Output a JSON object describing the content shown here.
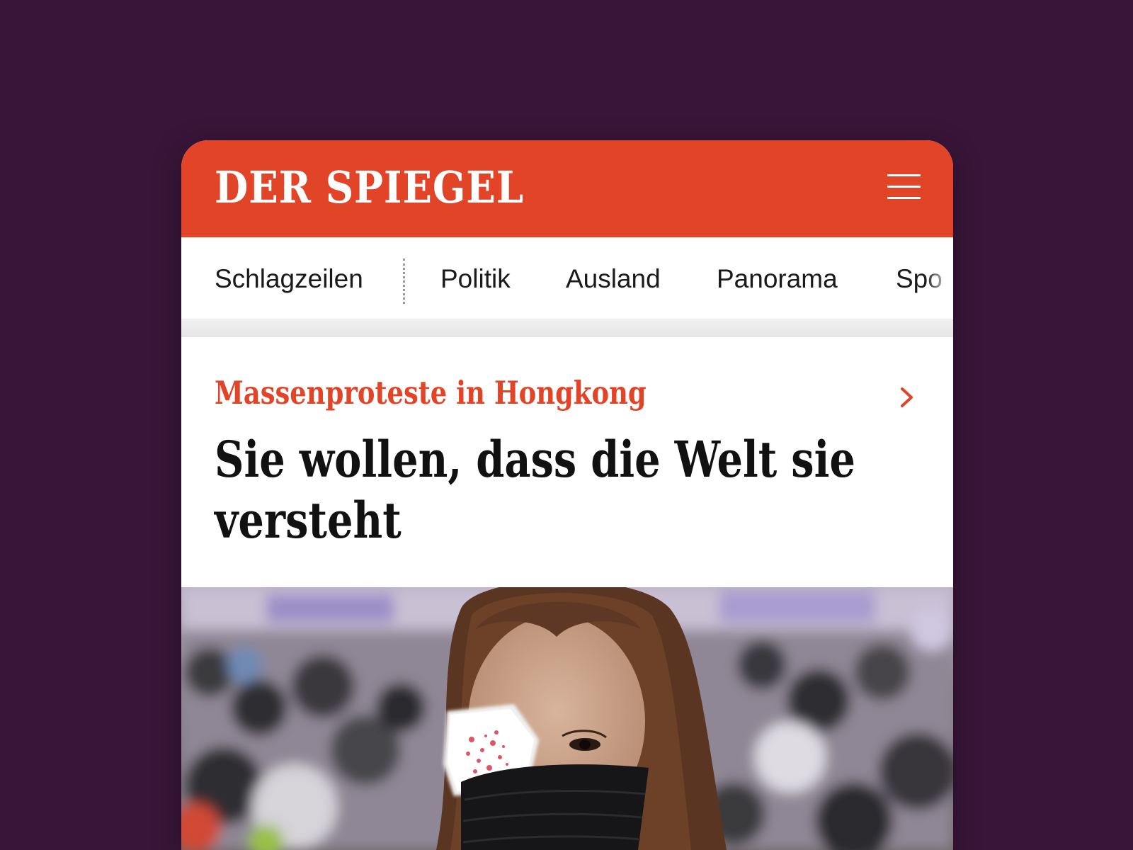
{
  "header": {
    "logo_text": "DER SPIEGEL",
    "menu_icon": "hamburger-menu-icon",
    "brand_color": "#e14426"
  },
  "nav": {
    "items": [
      {
        "label": "Schlagzeilen"
      },
      {
        "label": "Politik"
      },
      {
        "label": "Ausland"
      },
      {
        "label": "Panorama"
      },
      {
        "label": "Spo"
      }
    ]
  },
  "article": {
    "kicker": "Massenproteste in Hongkong",
    "headline": "Sie wollen, dass die Welt sie versteht",
    "chevron_icon": "chevron-right-icon",
    "image_icon": "protester-photo"
  },
  "colors": {
    "background": "#391539",
    "accent": "#e14426",
    "text": "#111111"
  }
}
